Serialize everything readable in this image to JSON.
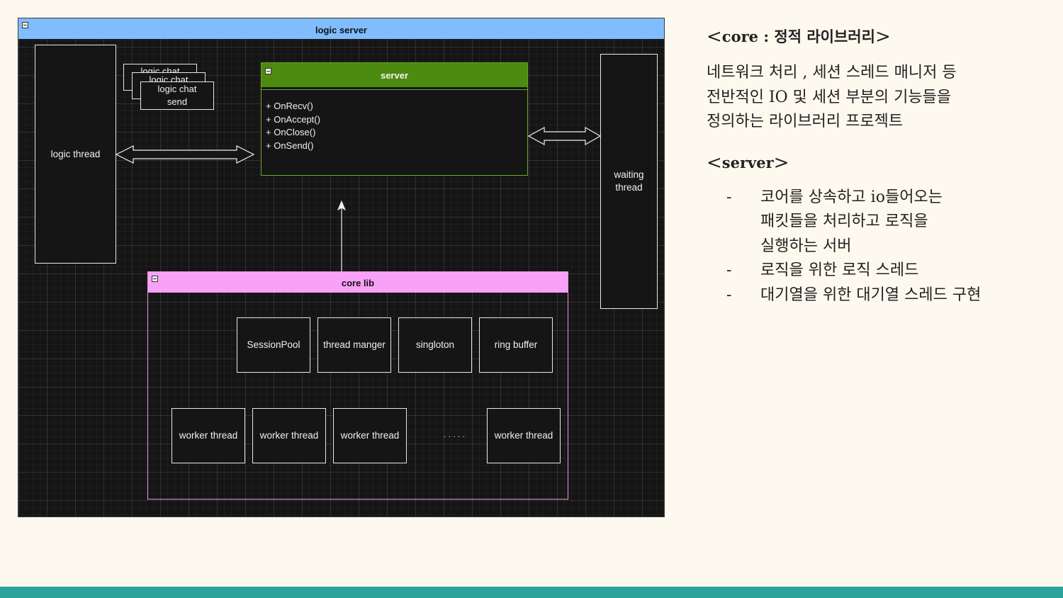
{
  "diagram": {
    "logic_server_title": "logic server",
    "logic_thread_label": "logic thread",
    "logic_chat_cards": [
      "logic chat",
      "logic chat",
      "logic chat send"
    ],
    "server_title": "server",
    "server_methods": [
      "+ OnRecv()",
      "+ OnAccept()",
      "+ OnClose()",
      "+ OnSend()"
    ],
    "waiting_thread_label": "waiting thread",
    "core_lib_title": "core lib",
    "core_lib_components": [
      "SessionPool",
      "thread manger",
      "singloton",
      "ring buffer"
    ],
    "worker_threads": [
      "worker thread",
      "worker thread",
      "worker thread",
      "worker thread"
    ],
    "ellipsis": ". . . . .",
    "colors": {
      "logic_server_header": "#80bdff",
      "server_header": "#4d8a10",
      "server_border": "#6aa82a",
      "core_lib_header": "#f7a1f7",
      "core_lib_border": "#e29ae2"
    }
  },
  "notes": {
    "core_heading": "core : 정적 라이브러리",
    "core_open": "<",
    "core_close": ">",
    "core_desc_lines": [
      "네트워크 처리 , 세션 스레드 매니저 등",
      "전반적인 IO 및 세션 부분의 기능들을",
      "정의하는 라이브러리 프로젝트"
    ],
    "server_heading": "server",
    "server_open": "<",
    "server_close": ">",
    "bullet_dash": "-",
    "bullets": [
      [
        "코어를 상속하고 io들어오는",
        "패킷들을 처리하고 로직을",
        "실행하는 서버"
      ],
      [
        "로직을 위한 로직 스레드"
      ],
      [
        "대기열을 위한 대기열 스레드 구현"
      ]
    ]
  },
  "footer": {
    "bar_color": "#2ba39a"
  }
}
